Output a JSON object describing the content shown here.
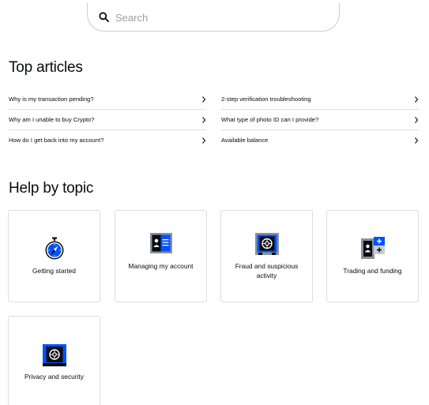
{
  "search": {
    "placeholder": "Search",
    "icon": "search-icon"
  },
  "top_articles": {
    "title": "Top articles",
    "left": [
      {
        "label": "Why is my transaction pending?"
      },
      {
        "label": "Why am I unable to buy Crypto?"
      },
      {
        "label": "How do I get back into my account?"
      }
    ],
    "right": [
      {
        "label": "2-step verification troubleshooting"
      },
      {
        "label": "What type of photo ID can I provide?"
      },
      {
        "label": "Available balance"
      }
    ]
  },
  "help_by_topic": {
    "title": "Help by topic",
    "cards": [
      {
        "label": "Getting started",
        "icon": "compass-icon"
      },
      {
        "label": "Managing my account",
        "icon": "id-card-icon"
      },
      {
        "label": "Fraud and suspicious activity",
        "icon": "safe-icon"
      },
      {
        "label": "Trading and funding",
        "icon": "trading-icon"
      },
      {
        "label": "Privacy and security",
        "icon": "vault-icon"
      }
    ]
  },
  "colors": {
    "brand_blue": "#0052ff",
    "text": "#0a0b0d",
    "divider": "#dedfe2",
    "border": "#dcdde0"
  }
}
